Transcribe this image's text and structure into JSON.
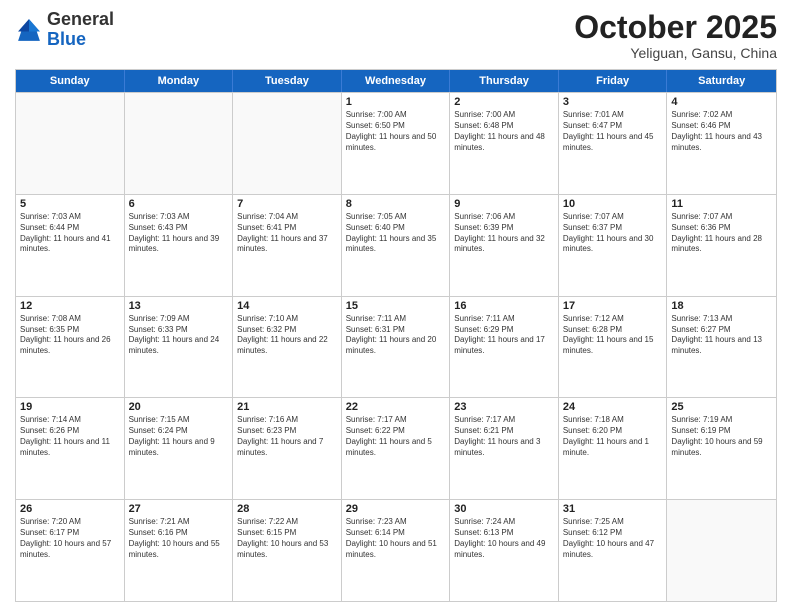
{
  "logo": {
    "general": "General",
    "blue": "Blue"
  },
  "header": {
    "month": "October 2025",
    "location": "Yeliguan, Gansu, China"
  },
  "weekdays": [
    "Sunday",
    "Monday",
    "Tuesday",
    "Wednesday",
    "Thursday",
    "Friday",
    "Saturday"
  ],
  "rows": [
    [
      {
        "day": "",
        "empty": true
      },
      {
        "day": "",
        "empty": true
      },
      {
        "day": "",
        "empty": true
      },
      {
        "day": "1",
        "sunrise": "Sunrise: 7:00 AM",
        "sunset": "Sunset: 6:50 PM",
        "daylight": "Daylight: 11 hours and 50 minutes."
      },
      {
        "day": "2",
        "sunrise": "Sunrise: 7:00 AM",
        "sunset": "Sunset: 6:48 PM",
        "daylight": "Daylight: 11 hours and 48 minutes."
      },
      {
        "day": "3",
        "sunrise": "Sunrise: 7:01 AM",
        "sunset": "Sunset: 6:47 PM",
        "daylight": "Daylight: 11 hours and 45 minutes."
      },
      {
        "day": "4",
        "sunrise": "Sunrise: 7:02 AM",
        "sunset": "Sunset: 6:46 PM",
        "daylight": "Daylight: 11 hours and 43 minutes."
      }
    ],
    [
      {
        "day": "5",
        "sunrise": "Sunrise: 7:03 AM",
        "sunset": "Sunset: 6:44 PM",
        "daylight": "Daylight: 11 hours and 41 minutes."
      },
      {
        "day": "6",
        "sunrise": "Sunrise: 7:03 AM",
        "sunset": "Sunset: 6:43 PM",
        "daylight": "Daylight: 11 hours and 39 minutes."
      },
      {
        "day": "7",
        "sunrise": "Sunrise: 7:04 AM",
        "sunset": "Sunset: 6:41 PM",
        "daylight": "Daylight: 11 hours and 37 minutes."
      },
      {
        "day": "8",
        "sunrise": "Sunrise: 7:05 AM",
        "sunset": "Sunset: 6:40 PM",
        "daylight": "Daylight: 11 hours and 35 minutes."
      },
      {
        "day": "9",
        "sunrise": "Sunrise: 7:06 AM",
        "sunset": "Sunset: 6:39 PM",
        "daylight": "Daylight: 11 hours and 32 minutes."
      },
      {
        "day": "10",
        "sunrise": "Sunrise: 7:07 AM",
        "sunset": "Sunset: 6:37 PM",
        "daylight": "Daylight: 11 hours and 30 minutes."
      },
      {
        "day": "11",
        "sunrise": "Sunrise: 7:07 AM",
        "sunset": "Sunset: 6:36 PM",
        "daylight": "Daylight: 11 hours and 28 minutes."
      }
    ],
    [
      {
        "day": "12",
        "sunrise": "Sunrise: 7:08 AM",
        "sunset": "Sunset: 6:35 PM",
        "daylight": "Daylight: 11 hours and 26 minutes."
      },
      {
        "day": "13",
        "sunrise": "Sunrise: 7:09 AM",
        "sunset": "Sunset: 6:33 PM",
        "daylight": "Daylight: 11 hours and 24 minutes."
      },
      {
        "day": "14",
        "sunrise": "Sunrise: 7:10 AM",
        "sunset": "Sunset: 6:32 PM",
        "daylight": "Daylight: 11 hours and 22 minutes."
      },
      {
        "day": "15",
        "sunrise": "Sunrise: 7:11 AM",
        "sunset": "Sunset: 6:31 PM",
        "daylight": "Daylight: 11 hours and 20 minutes."
      },
      {
        "day": "16",
        "sunrise": "Sunrise: 7:11 AM",
        "sunset": "Sunset: 6:29 PM",
        "daylight": "Daylight: 11 hours and 17 minutes."
      },
      {
        "day": "17",
        "sunrise": "Sunrise: 7:12 AM",
        "sunset": "Sunset: 6:28 PM",
        "daylight": "Daylight: 11 hours and 15 minutes."
      },
      {
        "day": "18",
        "sunrise": "Sunrise: 7:13 AM",
        "sunset": "Sunset: 6:27 PM",
        "daylight": "Daylight: 11 hours and 13 minutes."
      }
    ],
    [
      {
        "day": "19",
        "sunrise": "Sunrise: 7:14 AM",
        "sunset": "Sunset: 6:26 PM",
        "daylight": "Daylight: 11 hours and 11 minutes."
      },
      {
        "day": "20",
        "sunrise": "Sunrise: 7:15 AM",
        "sunset": "Sunset: 6:24 PM",
        "daylight": "Daylight: 11 hours and 9 minutes."
      },
      {
        "day": "21",
        "sunrise": "Sunrise: 7:16 AM",
        "sunset": "Sunset: 6:23 PM",
        "daylight": "Daylight: 11 hours and 7 minutes."
      },
      {
        "day": "22",
        "sunrise": "Sunrise: 7:17 AM",
        "sunset": "Sunset: 6:22 PM",
        "daylight": "Daylight: 11 hours and 5 minutes."
      },
      {
        "day": "23",
        "sunrise": "Sunrise: 7:17 AM",
        "sunset": "Sunset: 6:21 PM",
        "daylight": "Daylight: 11 hours and 3 minutes."
      },
      {
        "day": "24",
        "sunrise": "Sunrise: 7:18 AM",
        "sunset": "Sunset: 6:20 PM",
        "daylight": "Daylight: 11 hours and 1 minute."
      },
      {
        "day": "25",
        "sunrise": "Sunrise: 7:19 AM",
        "sunset": "Sunset: 6:19 PM",
        "daylight": "Daylight: 10 hours and 59 minutes."
      }
    ],
    [
      {
        "day": "26",
        "sunrise": "Sunrise: 7:20 AM",
        "sunset": "Sunset: 6:17 PM",
        "daylight": "Daylight: 10 hours and 57 minutes."
      },
      {
        "day": "27",
        "sunrise": "Sunrise: 7:21 AM",
        "sunset": "Sunset: 6:16 PM",
        "daylight": "Daylight: 10 hours and 55 minutes."
      },
      {
        "day": "28",
        "sunrise": "Sunrise: 7:22 AM",
        "sunset": "Sunset: 6:15 PM",
        "daylight": "Daylight: 10 hours and 53 minutes."
      },
      {
        "day": "29",
        "sunrise": "Sunrise: 7:23 AM",
        "sunset": "Sunset: 6:14 PM",
        "daylight": "Daylight: 10 hours and 51 minutes."
      },
      {
        "day": "30",
        "sunrise": "Sunrise: 7:24 AM",
        "sunset": "Sunset: 6:13 PM",
        "daylight": "Daylight: 10 hours and 49 minutes."
      },
      {
        "day": "31",
        "sunrise": "Sunrise: 7:25 AM",
        "sunset": "Sunset: 6:12 PM",
        "daylight": "Daylight: 10 hours and 47 minutes."
      },
      {
        "day": "",
        "empty": true
      }
    ]
  ]
}
